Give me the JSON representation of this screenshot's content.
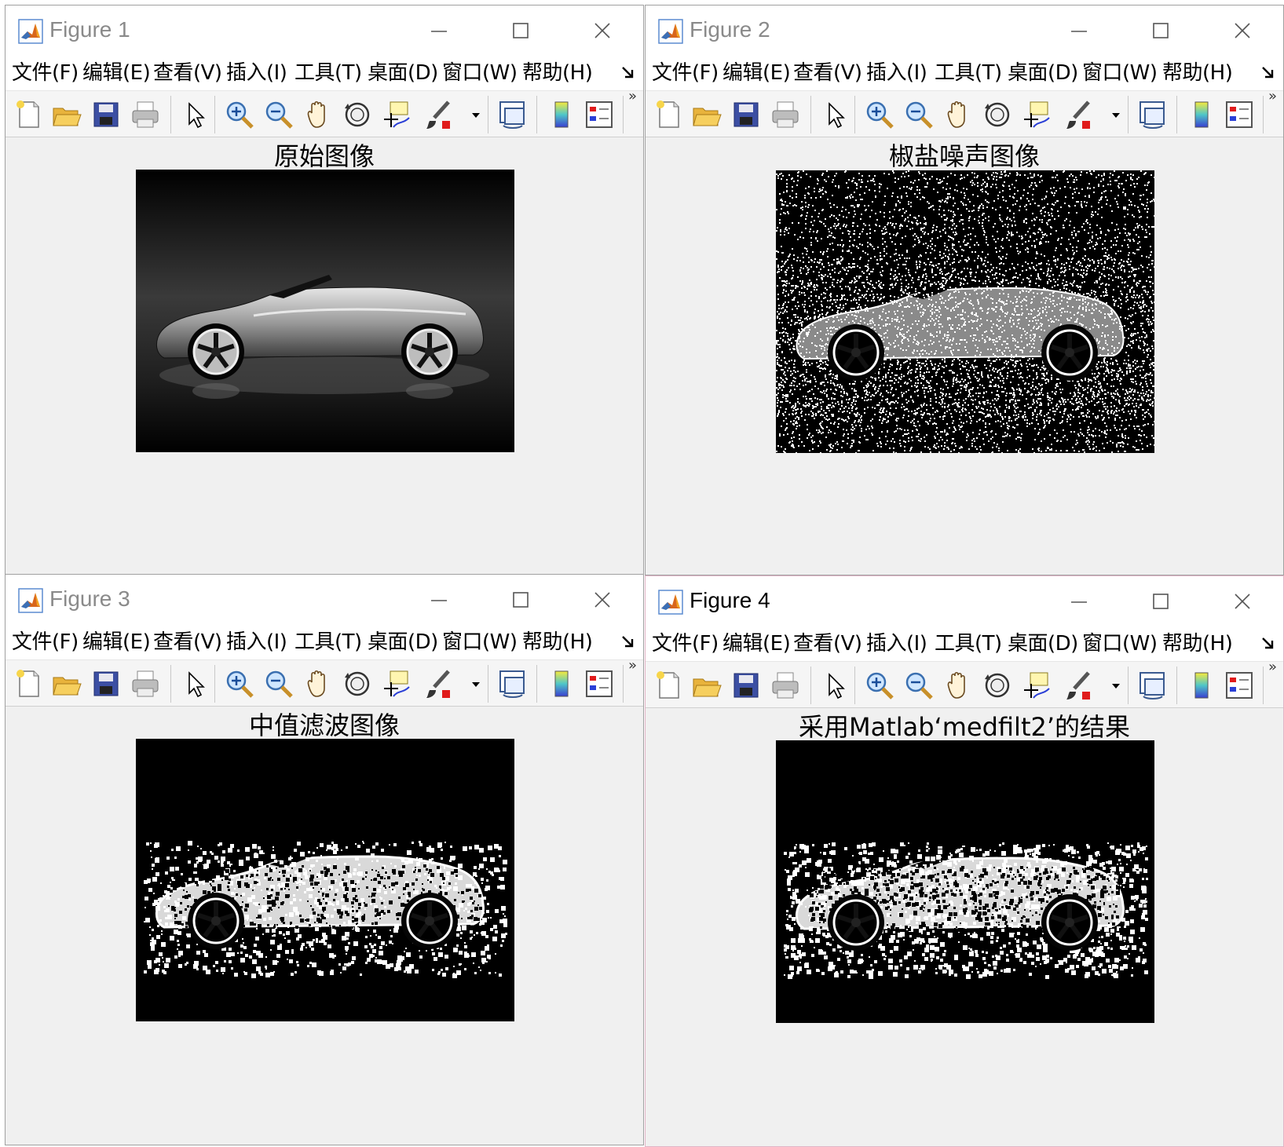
{
  "windows": [
    {
      "title": "Figure 1",
      "axes_title": "原始图像",
      "image": "grayscale photo of silver convertible sports car on black background",
      "active": false
    },
    {
      "title": "Figure 2",
      "axes_title": "椒盐噪声图像",
      "image": "car photo with salt-and-pepper noise",
      "active": false
    },
    {
      "title": "Figure 3",
      "axes_title": "中值滤波图像",
      "image": "median filtered binary-like car image",
      "active": false
    },
    {
      "title": "Figure 4",
      "axes_title": "采用Matlab‘medfilt2’的结果",
      "image": "result of medfilt2 on noisy car image",
      "active": true
    }
  ],
  "menu": [
    "文件(F)",
    "编辑(E)",
    "查看(V)",
    "插入(I)",
    "工具(T)",
    "桌面(D)",
    "窗口(W)",
    "帮助(H)"
  ],
  "toolbar_icons": [
    "new-figure-icon",
    "open-file-icon",
    "save-icon",
    "print-icon",
    "edit-plot-arrow-icon",
    "zoom-in-icon",
    "zoom-out-icon",
    "pan-hand-icon",
    "rotate-3d-icon",
    "data-cursor-icon",
    "brush-icon",
    "link-plot-icon",
    "colorbar-icon",
    "legend-icon"
  ],
  "colors": {
    "window_bg": "#f0f0f0",
    "titlebar_bg": "#ffffff",
    "active_border": "#e2b4c6",
    "inactive_title": "#8a8a8a"
  }
}
